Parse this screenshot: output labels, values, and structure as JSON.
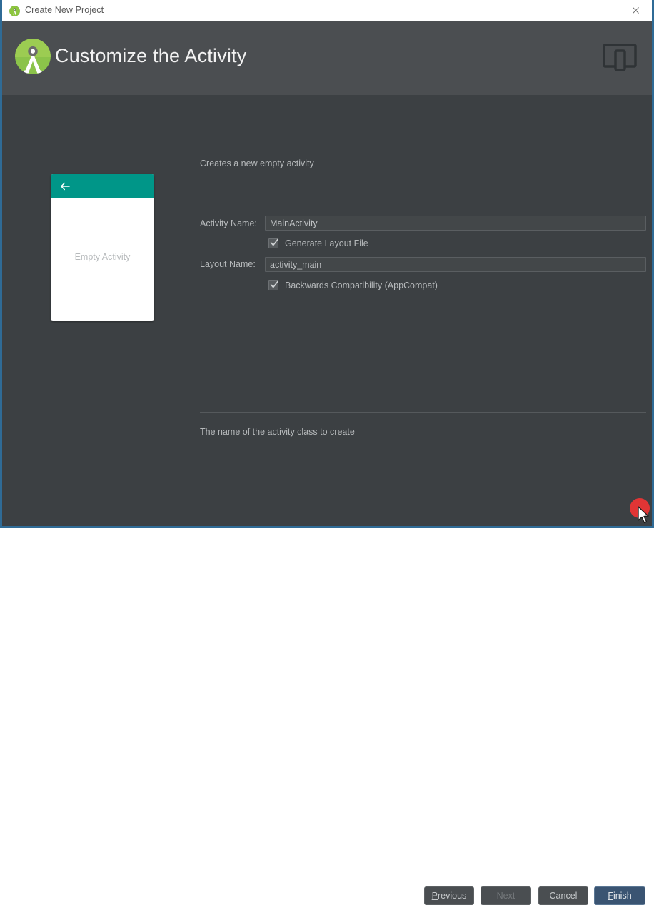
{
  "titlebar": {
    "title": "Create New Project",
    "app_icon": "android-studio-icon",
    "close_label": "✕"
  },
  "header": {
    "title": "Customize the Activity",
    "logo_icon": "android-studio-logo",
    "device_icon": "phone-and-tablet-icon"
  },
  "preview": {
    "label": "Empty Activity",
    "appbar_color": "#009688",
    "back_icon": "back-arrow-icon"
  },
  "form": {
    "description": "Creates a new empty activity",
    "activity_name": {
      "label": "Activity Name:",
      "value": "MainActivity"
    },
    "generate_layout": {
      "label": "Generate Layout File",
      "checked": true
    },
    "layout_name": {
      "label": "Layout Name:",
      "value": "activity_main"
    },
    "backwards_compat": {
      "label": "Backwards Compatibility (AppCompat)",
      "checked": true
    },
    "help_text": "The name of the activity class to create"
  },
  "buttons": {
    "previous": {
      "label": "Previous",
      "mnemonic": "P",
      "enabled": true
    },
    "next": {
      "label": "Next",
      "mnemonic": "N",
      "enabled": false
    },
    "cancel": {
      "label": "Cancel",
      "mnemonic": "",
      "enabled": true
    },
    "finish": {
      "label": "Finish",
      "mnemonic": "F",
      "enabled": true,
      "default": true
    }
  },
  "colors": {
    "accent_teal": "#009688",
    "window_border": "#2f6b96",
    "header_bg": "#4b4e51",
    "body_bg": "#3c4043",
    "click_marker": "#f03434"
  },
  "pointer": {
    "cursor_icon": "mouse-arrow-cursor",
    "click_marker_icon": "red-click-dot"
  }
}
